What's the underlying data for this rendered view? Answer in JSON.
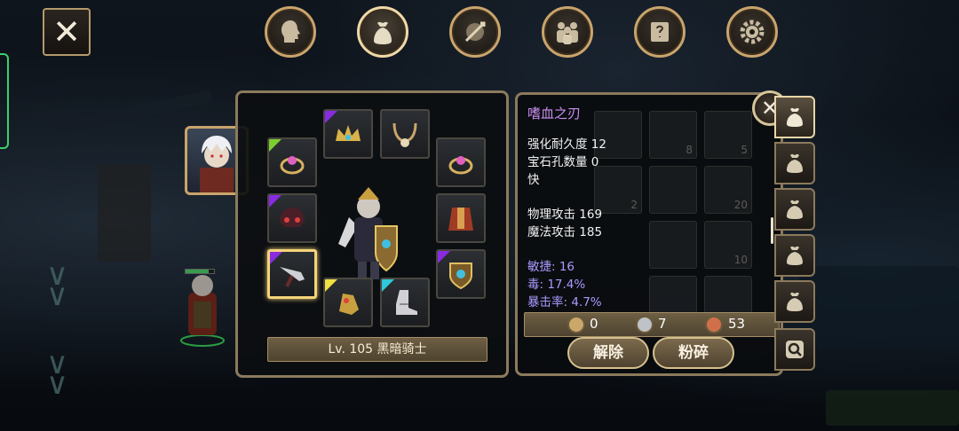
{
  "window": {
    "close_icon": "x-icon"
  },
  "top_tabs": [
    {
      "id": "profile",
      "icon": "head-silhouette-icon",
      "active": false
    },
    {
      "id": "inventory",
      "icon": "bag-icon",
      "active": true
    },
    {
      "id": "skills",
      "icon": "sword-burst-icon",
      "active": false
    },
    {
      "id": "party",
      "icon": "group-people-icon",
      "active": false
    },
    {
      "id": "quests",
      "icon": "scroll-icon",
      "active": false
    },
    {
      "id": "settings",
      "icon": "gear-icon",
      "active": false
    }
  ],
  "equipment": {
    "level_label": "Lv. 105 黑暗骑士",
    "slots": [
      {
        "id": "crown",
        "icon": "crown-icon",
        "rarity_color": "#8a2be2"
      },
      {
        "id": "necklace",
        "icon": "necklace-icon",
        "rarity_color": ""
      },
      {
        "id": "ring-left",
        "icon": "ring-icon",
        "rarity_color": "#7ccd2e"
      },
      {
        "id": "ring-right",
        "icon": "ring-icon",
        "rarity_color": ""
      },
      {
        "id": "helmet",
        "icon": "dark-helmet-icon",
        "rarity_color": "#8a2be2"
      },
      {
        "id": "armor",
        "icon": "cloak-armor-icon",
        "rarity_color": ""
      },
      {
        "id": "weapon",
        "icon": "blade-icon",
        "rarity_color": "#8a2be2",
        "selected": true
      },
      {
        "id": "gloves",
        "icon": "gauntlet-icon",
        "rarity_color": "#f0e040"
      },
      {
        "id": "boots",
        "icon": "boots-icon",
        "rarity_color": "#2ec8d8"
      },
      {
        "id": "shield",
        "icon": "shield-icon",
        "rarity_color": "#8a2be2"
      }
    ]
  },
  "item_detail": {
    "name": "嗜血之刃",
    "name_color": "#c98ef0",
    "stats_basic": [
      "强化耐久度 12",
      "宝石孔数量 0",
      "快"
    ],
    "stats_attack": [
      "物理攻击 169",
      "魔法攻击 185"
    ],
    "stats_bonus": [
      "敏捷: 16",
      "毒: 17.4%",
      "暴击率: 4.7%"
    ],
    "background_counts": [
      "8",
      "5",
      "2",
      "20",
      "10"
    ],
    "currency": [
      {
        "type": "gold",
        "icon": "gold-coin-icon",
        "value": "0",
        "color": "#caa86a"
      },
      {
        "type": "silver",
        "icon": "silver-coin-icon",
        "value": "7",
        "color": "#bfc3c8"
      },
      {
        "type": "copper",
        "icon": "copper-coin-icon",
        "value": "53",
        "color": "#d0704a"
      }
    ],
    "buttons": {
      "unequip": "解除",
      "smash": "粉碎"
    }
  },
  "bag_tabs": [
    {
      "id": "bag-1",
      "icon": "bag-icon",
      "active": true
    },
    {
      "id": "bag-2",
      "icon": "bag-icon",
      "active": false
    },
    {
      "id": "bag-3",
      "icon": "bag-icon",
      "active": false
    },
    {
      "id": "bag-4",
      "icon": "bag-icon",
      "active": false
    },
    {
      "id": "bag-5",
      "icon": "bag-icon",
      "active": false
    },
    {
      "id": "search",
      "icon": "magnifier-icon",
      "active": false
    }
  ],
  "colors": {
    "frame_gold": "#c9a46c",
    "stat_purple": "#a999ff"
  }
}
